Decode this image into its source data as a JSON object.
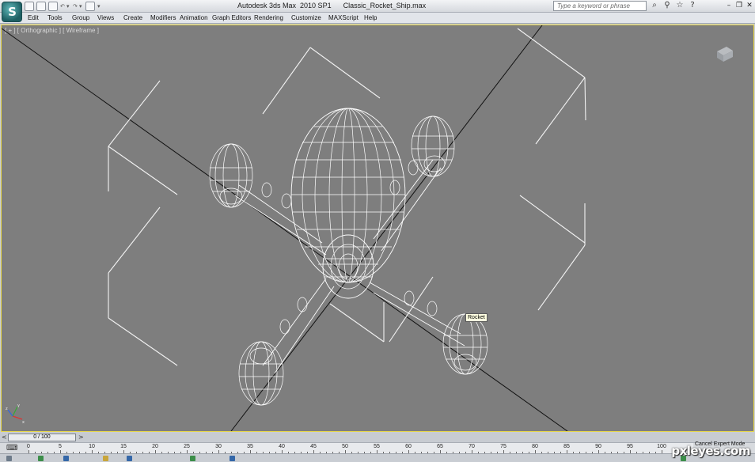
{
  "window": {
    "title": "Autodesk 3ds Max  2010 SP1      Classic_Rocket_Ship.max",
    "search_placeholder": "Type a keyword or phrase"
  },
  "menu": [
    "Edit",
    "Tools",
    "Group",
    "Views",
    "Create",
    "Modifiers",
    "Animation",
    "Graph Editors",
    "Rendering",
    "Customize",
    "MAXScript",
    "Help"
  ],
  "viewport": {
    "label": "[ + ] [ Orthographic ] [ Wireframe ]",
    "tooltip": "Rocket",
    "background_color": "#7e7e7e",
    "wire_color": "#ffffff",
    "active_border_color": "#e9d94a"
  },
  "timeline": {
    "frame_display": "0 / 100",
    "ticks": [
      "0",
      "5",
      "10",
      "15",
      "20",
      "25",
      "30",
      "35",
      "40",
      "45",
      "50",
      "55",
      "60",
      "65",
      "70",
      "75",
      "80",
      "85",
      "90",
      "95",
      "100"
    ]
  },
  "status": {
    "expert_mode": "Cancel Expert Mode"
  },
  "icons": [
    "app-logo-icon",
    "new-file-icon",
    "open-file-icon",
    "save-icon",
    "undo-icon",
    "redo-icon",
    "project-icon",
    "binoculars-icon",
    "search-icon",
    "star-icon",
    "help-icon",
    "minimize-icon",
    "restore-icon",
    "close-icon",
    "viewcube-icon",
    "axis-tripod-icon",
    "set-key-icon"
  ],
  "watermark": "pxleyes.com"
}
